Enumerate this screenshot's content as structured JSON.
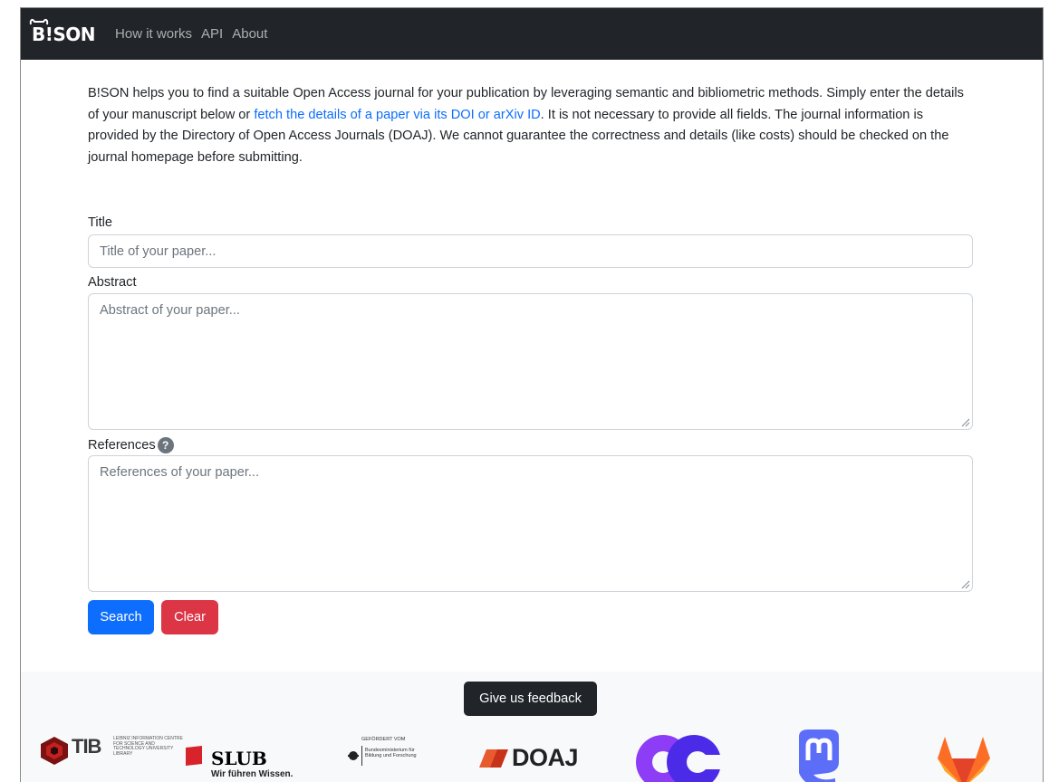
{
  "navbar": {
    "brand": "B!SON",
    "links": [
      "How it works",
      "API",
      "About"
    ]
  },
  "intro": {
    "text_before": "B!SON helps you to find a suitable Open Access journal for your publication by leveraging semantic and bibliometric methods. Simply enter the details of your manuscript below or ",
    "link": "fetch the details of a paper via its DOI or arXiv ID",
    "text_after": ". It is not necessary to provide all fields. The journal information is provided by the Directory of Open Access Journals (DOAJ). We cannot guarantee the correctness and details (like costs) should be checked on the journal homepage before submitting."
  },
  "form": {
    "title_label": "Title",
    "title_placeholder": "Title of your paper...",
    "abstract_label": "Abstract",
    "abstract_placeholder": "Abstract of your paper...",
    "references_label": "References",
    "references_help": "?",
    "references_placeholder": "References of your paper...",
    "search_label": "Search",
    "clear_label": "Clear"
  },
  "footer": {
    "feedback_label": "Give us feedback",
    "logos": {
      "tib": "TIB",
      "tib_small": "LEIBNIZ INFORMATION CENTRE FOR SCIENCE AND TECHNOLOGY UNIVERSITY LIBRARY",
      "slub": "SLUB",
      "slub_sub": "Wir führen Wissen.",
      "bmbf_top": "GEFÖRDERT VOM",
      "bmbf": "Bundesministerium für Bildung und Forschung",
      "doaj": "DOAJ",
      "opencitations": "opencitations-logo",
      "mastodon": "mastodon-logo",
      "gitlab": "gitlab-logo"
    }
  },
  "colors": {
    "navbar": "#212529",
    "link": "#0d6efd",
    "search_button": "#0d6efd",
    "clear_button": "#dc3545",
    "footer_bg": "#f8f9fa"
  }
}
